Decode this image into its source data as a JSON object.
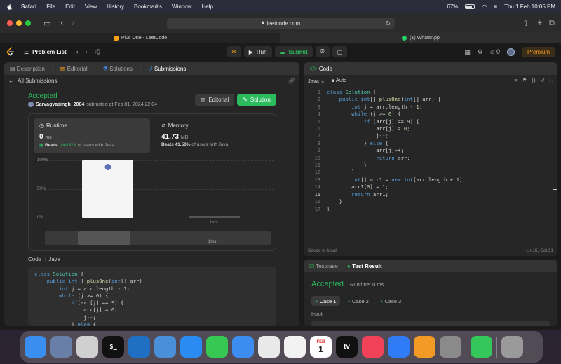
{
  "menubar": {
    "app": "Safari",
    "items": [
      "File",
      "Edit",
      "View",
      "History",
      "Bookmarks",
      "Window",
      "Help"
    ],
    "battery": "67%",
    "datetime": "Thu 1 Feb  10:05 PM"
  },
  "safari": {
    "url": "leetcode.com",
    "tabs": [
      {
        "title": "Plus One - LeetCode"
      },
      {
        "title": "(1) WhatsApp"
      }
    ]
  },
  "lc_header": {
    "problem_list": "Problem List",
    "run": "Run",
    "submit": "Submit",
    "streak": "0",
    "premium": "Premium"
  },
  "left_tabs": [
    "Description",
    "Editorial",
    "Solutions",
    "Submissions"
  ],
  "submission": {
    "back": "All Submissions",
    "status": "Accepted",
    "user": "Sarvagyasingh_2004",
    "submitted": "submitted at Feb 01, 2024 22:04",
    "editorial_btn": "Editorial",
    "solution_btn": "Solution",
    "runtime_label": "Runtime",
    "runtime_value": "0",
    "runtime_unit": "ms",
    "runtime_beats_pre": "Beats",
    "runtime_beats": "100.00%",
    "runtime_beats_post": "of users with Java",
    "memory_label": "Memory",
    "memory_value": "41.73",
    "memory_unit": "MB",
    "memory_beats_pre": "Beats",
    "memory_beats": "41.50%",
    "memory_beats_post": "of users with Java",
    "code_label": "Code",
    "code_lang": "Java"
  },
  "chart_data": {
    "type": "bar",
    "yticks": [
      "100%",
      "50%",
      "0%"
    ],
    "x_label": "1ms",
    "scrub_label": "1ms",
    "bars": [
      {
        "label": "0ms",
        "value": 100
      },
      {
        "label": "1ms",
        "value": 2
      }
    ],
    "ylim": [
      0,
      100
    ]
  },
  "editor": {
    "title": "Code",
    "language": "Java",
    "mode": "Auto",
    "saved": "Saved to local",
    "cursor": "Ln 15, Col 21",
    "line_numbers": [
      "1",
      "2",
      "3",
      "4",
      "5",
      "6",
      "7",
      "8",
      "9",
      "10",
      "11",
      "12",
      "13",
      "14",
      "15",
      "16",
      "17"
    ]
  },
  "result": {
    "tab1": "Testcase",
    "tab2": "Test Result",
    "status": "Accepted",
    "runtime": "Runtime: 0 ms",
    "cases": [
      "Case 1",
      "Case 2",
      "Case 3"
    ],
    "input_label": "Input"
  },
  "dock": {
    "apps": [
      {
        "name": "Finder",
        "color": "#3a8ef0"
      },
      {
        "name": "Preview",
        "color": "#6a7fa8"
      },
      {
        "name": "Launchpad",
        "color": "#d0d0d0"
      },
      {
        "name": "Terminal",
        "color": "#111111"
      },
      {
        "name": "VS Code",
        "color": "#1f6fc4"
      },
      {
        "name": "Xcode-like",
        "color": "#4a90d9"
      },
      {
        "name": "Safari",
        "color": "#2a8bf2"
      },
      {
        "name": "Messages",
        "color": "#37c853"
      },
      {
        "name": "Mail",
        "color": "#3d8cf0"
      },
      {
        "name": "Chrome",
        "color": "#e9e9e9"
      },
      {
        "name": "Photos",
        "color": "#f2f2f2"
      },
      {
        "name": "Calendar",
        "color": "#ffffff"
      },
      {
        "name": "TV",
        "color": "#111111"
      },
      {
        "name": "Music",
        "color": "#f1425a"
      },
      {
        "name": "App Store",
        "color": "#2f7cf6"
      },
      {
        "name": "Pages",
        "color": "#f29a25"
      },
      {
        "name": "System Settings",
        "color": "#8a8a8a"
      },
      {
        "name": "FaceTime",
        "color": "#34c759"
      },
      {
        "name": "Trash",
        "color": "#9a9a9a"
      }
    ],
    "calendar_month": "FEB",
    "calendar_day": "1",
    "tv_label": "tv"
  }
}
